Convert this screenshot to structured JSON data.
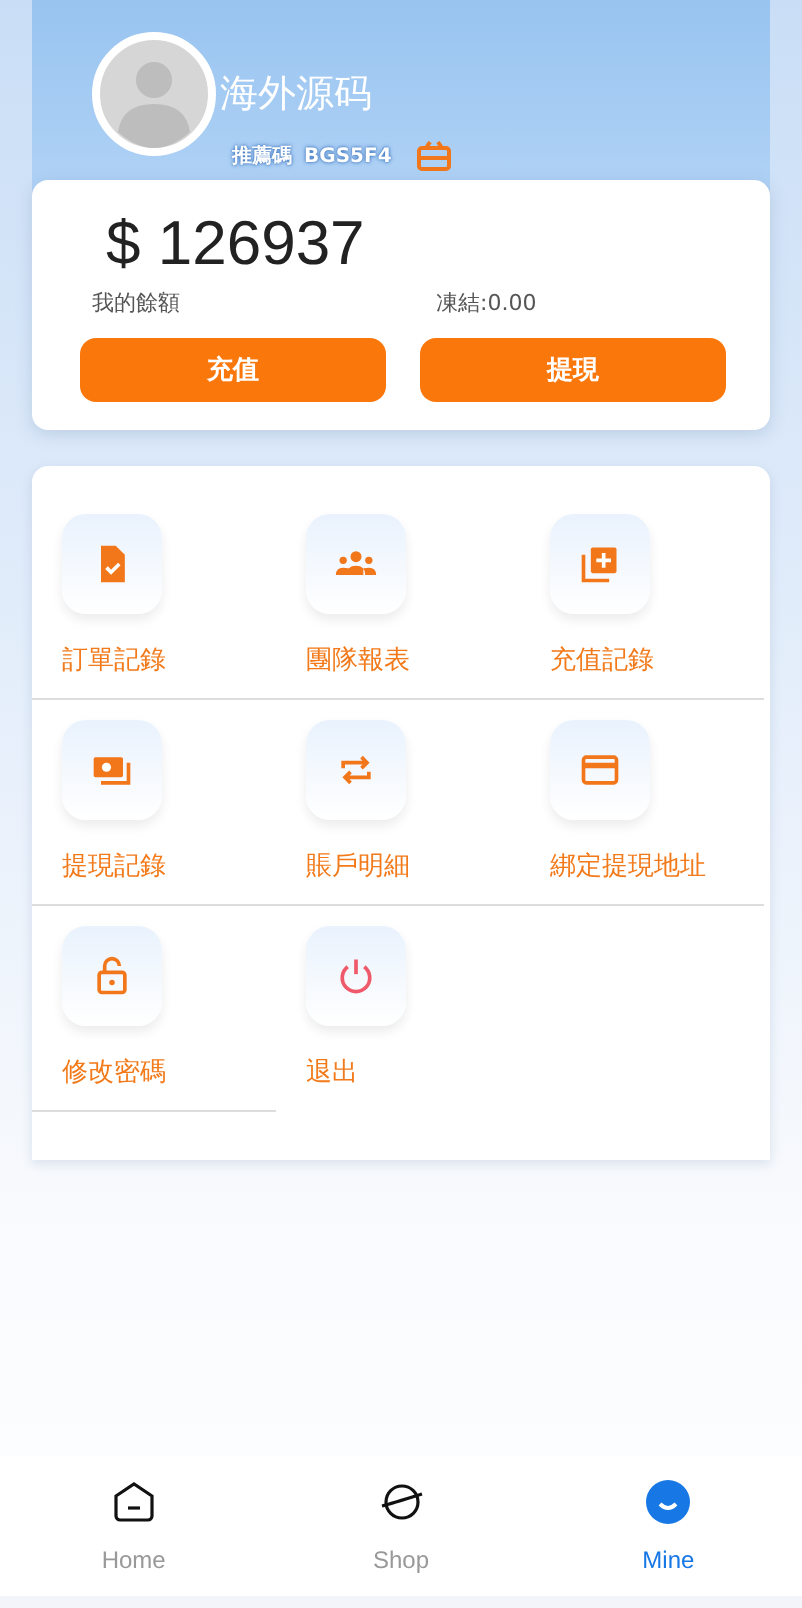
{
  "profile": {
    "name": "海外源码",
    "referral_label": "推薦碼",
    "referral_code": "BGS5F4"
  },
  "balance": {
    "amount": "$ 126937",
    "label": "我的餘額",
    "frozen": "凍結:0.00",
    "buttons": [
      "充值",
      "提現"
    ]
  },
  "menu": [
    {
      "label": "訂單記錄",
      "kind": "order"
    },
    {
      "label": "團隊報表",
      "kind": "team"
    },
    {
      "label": "充值記錄",
      "kind": "recharge"
    },
    {
      "label": "提現記錄",
      "kind": "withdraw"
    },
    {
      "label": "賬戶明細",
      "kind": "transfer"
    },
    {
      "label": "綁定提現地址",
      "kind": "card"
    },
    {
      "label": "修改密碼",
      "kind": "lock"
    },
    {
      "label": "退出",
      "kind": "logout"
    }
  ],
  "tabs": [
    {
      "label": "Home",
      "kind": "home",
      "selected": false
    },
    {
      "label": "Shop",
      "kind": "shop",
      "selected": false
    },
    {
      "label": "Mine",
      "kind": "mine",
      "selected": true
    }
  ]
}
